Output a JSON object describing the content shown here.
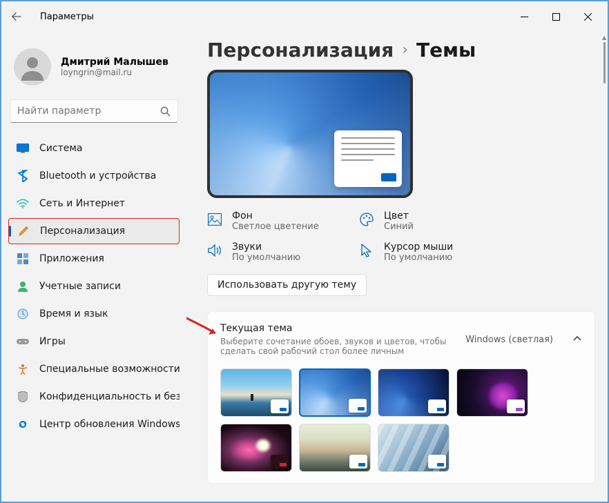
{
  "window": {
    "title": "Параметры"
  },
  "profile": {
    "name": "Дмитрий Малышев",
    "email": "loyngrin@mail.ru"
  },
  "search": {
    "placeholder": "Найти параметр"
  },
  "nav": {
    "items": [
      {
        "label": "Система"
      },
      {
        "label": "Bluetooth и устройства"
      },
      {
        "label": "Сеть и Интернет"
      },
      {
        "label": "Персонализация"
      },
      {
        "label": "Приложения"
      },
      {
        "label": "Учетные записи"
      },
      {
        "label": "Время и язык"
      },
      {
        "label": "Игры"
      },
      {
        "label": "Специальные возможности"
      },
      {
        "label": "Конфиденциальность и безопасность"
      },
      {
        "label": "Центр обновления Windows"
      }
    ]
  },
  "breadcrumb": {
    "parent": "Персонализация",
    "current": "Темы"
  },
  "theme": {
    "bg_label": "Фон",
    "bg_value": "Светлое цветение",
    "color_label": "Цвет",
    "color_value": "Синий",
    "sound_label": "Звуки",
    "sound_value": "По умолчанию",
    "cursor_label": "Курсор мыши",
    "cursor_value": "По умолчанию",
    "use_other": "Использовать другую тему"
  },
  "panel": {
    "title": "Текущая тема",
    "subtitle": "Выберите сочетание обоев, звуков и цветов, чтобы сделать свой рабочий стол более личным",
    "value": "Windows (светлая)"
  }
}
